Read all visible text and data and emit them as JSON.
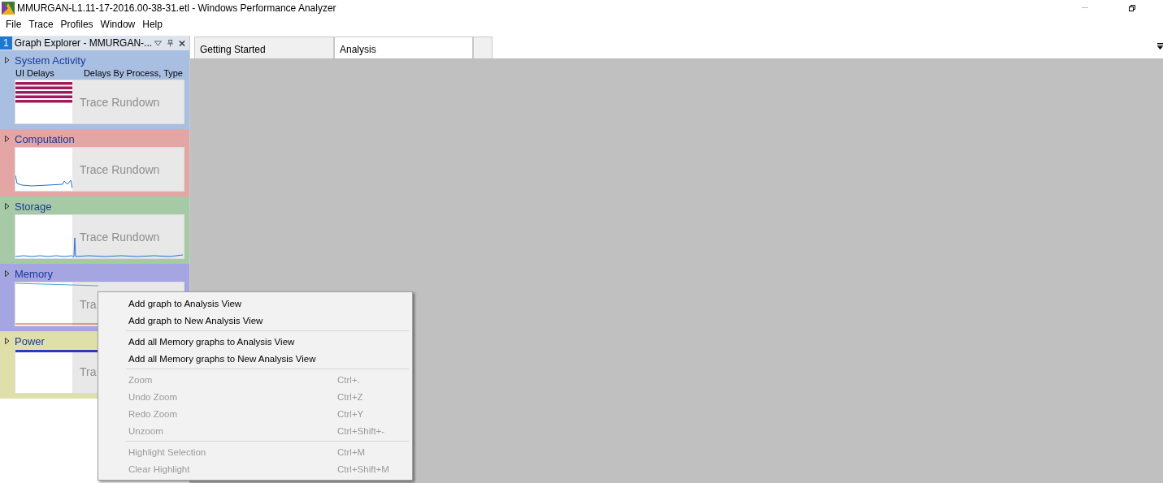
{
  "window": {
    "title": "MMURGAN-L1.11-17-2016.00-38-31.etl - Windows Performance Analyzer"
  },
  "menu_bar": [
    "File",
    "Trace",
    "Profiles",
    "Window",
    "Help"
  ],
  "graph_explorer": {
    "number": "1",
    "title": "Graph Explorer - MMURGAN-...",
    "categories": [
      {
        "name": "System Activity",
        "color": "#a8bfe2",
        "subtitles": [
          "UI Delays",
          "Delays By Process, Type"
        ],
        "kind": "stripes",
        "overlay": "Trace Rundown"
      },
      {
        "name": "Computation",
        "color": "#e4a5a5",
        "kind": "cpu",
        "overlay": "Trace Rundown"
      },
      {
        "name": "Storage",
        "color": "#a6c9a6",
        "kind": "spike",
        "overlay": "Trace Rundown"
      },
      {
        "name": "Memory",
        "color": "#a5a5e2",
        "kind": "memory",
        "overlay": "Tra"
      },
      {
        "name": "Power",
        "color": "#dfdfa9",
        "kind": "power",
        "overlay": "Tra"
      }
    ]
  },
  "tabs": [
    {
      "label": "Getting Started",
      "selected": false
    },
    {
      "label": "Analysis",
      "selected": true
    }
  ],
  "context_menu": [
    [
      {
        "label": "Add graph to Analysis View",
        "disabled": false
      },
      {
        "label": "Add graph to New Analysis View",
        "disabled": false
      }
    ],
    [
      {
        "label": "Add all Memory graphs to Analysis View",
        "disabled": false
      },
      {
        "label": "Add all Memory graphs to New Analysis View",
        "disabled": false
      }
    ],
    [
      {
        "label": "Zoom",
        "shortcut": "Ctrl+.",
        "disabled": true
      },
      {
        "label": "Undo Zoom",
        "shortcut": "Ctrl+Z",
        "disabled": true
      },
      {
        "label": "Redo Zoom",
        "shortcut": "Ctrl+Y",
        "disabled": true
      },
      {
        "label": "Unzoom",
        "shortcut": "Ctrl+Shift+-",
        "disabled": true
      }
    ],
    [
      {
        "label": "Highlight Selection",
        "shortcut": "Ctrl+M",
        "disabled": true
      },
      {
        "label": "Clear Highlight",
        "shortcut": "Ctrl+Shift+M",
        "disabled": true
      }
    ]
  ]
}
